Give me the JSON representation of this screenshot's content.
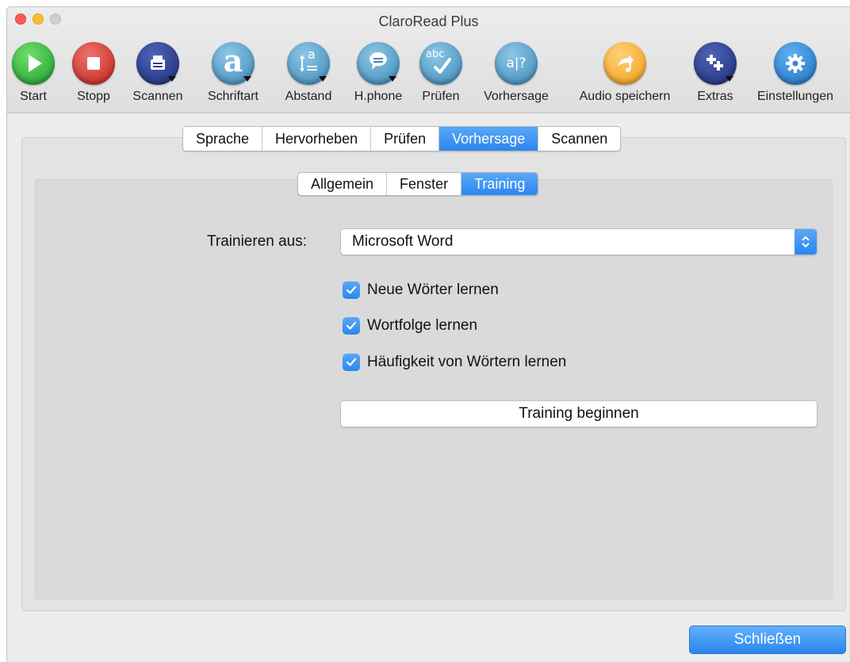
{
  "window": {
    "title": "ClaroRead Plus"
  },
  "toolbar": {
    "items": [
      {
        "label": "Start",
        "icon": "play-icon",
        "color": "#2fae3a"
      },
      {
        "label": "Stopp",
        "icon": "stop-icon",
        "color": "#d8332d"
      },
      {
        "label": "Scannen",
        "icon": "scanner-icon",
        "color": "#2a3f8f"
      },
      {
        "label": "Schriftart",
        "icon": "font-icon",
        "color": "#4f9ec9"
      },
      {
        "label": "Abstand",
        "icon": "spacing-icon",
        "color": "#4f9ec9"
      },
      {
        "label": "H.phone",
        "icon": "homophone-icon",
        "color": "#4f9ec9"
      },
      {
        "label": "Prüfen",
        "icon": "spellcheck-icon",
        "color": "#4f9ec9"
      },
      {
        "label": "Vorhersage",
        "icon": "prediction-icon",
        "color": "#4f9ec9"
      },
      {
        "label": "Audio speichern",
        "icon": "save-audio-icon",
        "color": "#f4a321"
      },
      {
        "label": "Extras",
        "icon": "extras-icon",
        "color": "#2a3f8f"
      },
      {
        "label": "Einstellungen",
        "icon": "gear-icon",
        "color": "#2f86d8"
      }
    ],
    "icon_glyphs": {
      "font": "a",
      "spacing": "a",
      "prediction": "a|?",
      "spellcheck": "abc",
      "extras": "+"
    }
  },
  "tabs": {
    "main": [
      "Sprache",
      "Hervorheben",
      "Prüfen",
      "Vorhersage",
      "Scannen"
    ],
    "main_active": "Vorhersage",
    "sub": [
      "Allgemein",
      "Fenster",
      "Training"
    ],
    "sub_active": "Training"
  },
  "form": {
    "train_from_label": "Trainieren aus:",
    "train_from_value": "Microsoft Word",
    "checkboxes": [
      {
        "label": "Neue Wörter lernen",
        "checked": true
      },
      {
        "label": "Wortfolge lernen",
        "checked": true
      },
      {
        "label": "Häufigkeit von Wörtern lernen",
        "checked": true
      }
    ],
    "start_training_label": "Training beginnen"
  },
  "footer": {
    "close_label": "Schließen"
  },
  "colors": {
    "accent": "#2a86ef"
  }
}
